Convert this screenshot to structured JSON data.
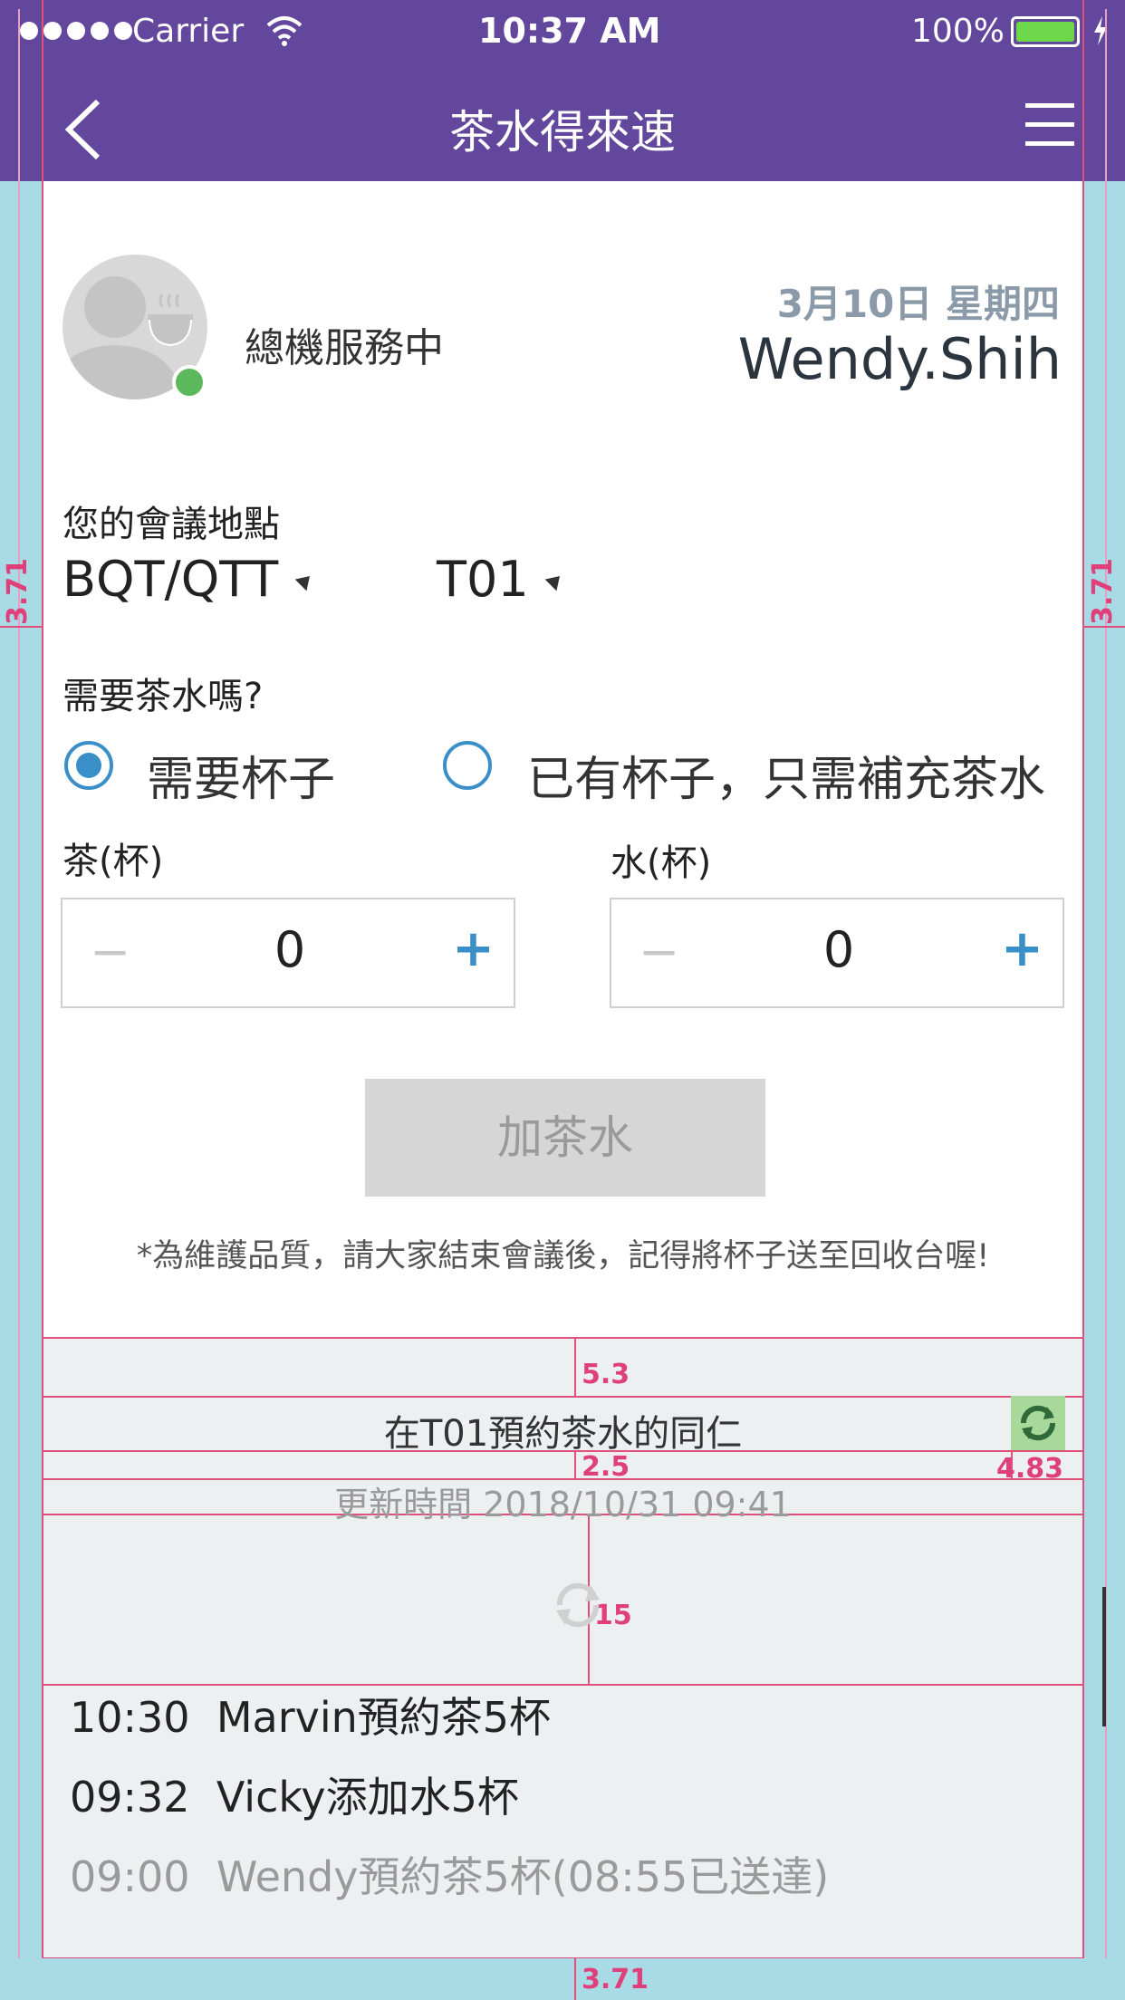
{
  "status_bar": {
    "carrier": "Carrier",
    "time": "10:37 AM",
    "battery": "100%"
  },
  "nav": {
    "title": "茶水得來速",
    "back_icon": "chevron-left-icon",
    "menu_icon": "hamburger-menu-icon"
  },
  "profile": {
    "status": "總機服務中",
    "date": "3月10日 星期四",
    "name": "Wendy.Shih"
  },
  "location": {
    "label": "您的會議地點",
    "building": "BQT/QTT",
    "room": "T01"
  },
  "need": {
    "label": "需要茶水嗎?",
    "option_cup": "需要杯子",
    "option_refill": "已有杯子，只需補充茶水",
    "selected": "option_cup"
  },
  "tea": {
    "label": "茶(杯)",
    "value": "0",
    "minus": "−",
    "plus": "+"
  },
  "water": {
    "label": "水(杯)",
    "value": "0",
    "minus": "−",
    "plus": "+"
  },
  "submit_label": "加茶水",
  "notice": "*為維護品質，請大家結束會議後，記得將杯子送至回收台喔!",
  "bookings": {
    "title": "在T01預約茶水的同仁",
    "updated": "更新時間 2018/10/31 09:41",
    "items": [
      {
        "time": "10:30",
        "text": "Marvin預約茶5杯"
      },
      {
        "time": "09:32",
        "text": "Vicky添加水5杯"
      },
      {
        "time": "09:00",
        "text": "Wendy預約茶5杯(08:55已送達)"
      }
    ]
  },
  "guides": {
    "side_left": "3.71",
    "side_right": "3.71",
    "gap_top": "5.3",
    "gap_title": "2.5",
    "refill_size": "4.83",
    "loader": "15",
    "bottom": "3.71"
  },
  "colors": {
    "header": "#63479c",
    "accent": "#3a8fc8",
    "online": "#5cb85c",
    "guide": "#e0507a"
  }
}
